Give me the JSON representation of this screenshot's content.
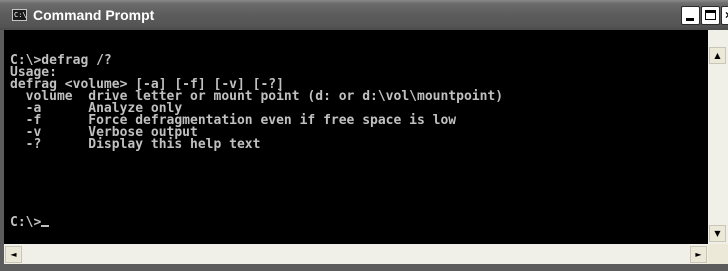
{
  "window": {
    "title": "Command Prompt",
    "icon": "console-icon",
    "icon_label": "C:\\",
    "buttons": {
      "minimize": "minimize-icon",
      "maximize": "maximize-icon",
      "close": "close-icon",
      "close_label": "×"
    }
  },
  "console": {
    "lines": [
      "C:\\>defrag /?",
      "Usage:",
      "defrag <volume> [-a] [-f] [-v] [-?]",
      "  volume  drive letter or mount point (d: or d:\\vol\\mountpoint)",
      "  -a      Analyze only",
      "  -f      Force defragmentation even if free space is low",
      "  -v      Verbose output",
      "  -?      Display this help text"
    ],
    "prompt": "C:\\>"
  },
  "scrollbars": {
    "up_arrow": "▲",
    "down_arrow": "▼",
    "left_arrow": "◄",
    "right_arrow": "►"
  },
  "colors": {
    "console_bg": "#000000",
    "console_fg": "#c0c0c0",
    "titlebar": "#5c5c5c"
  }
}
